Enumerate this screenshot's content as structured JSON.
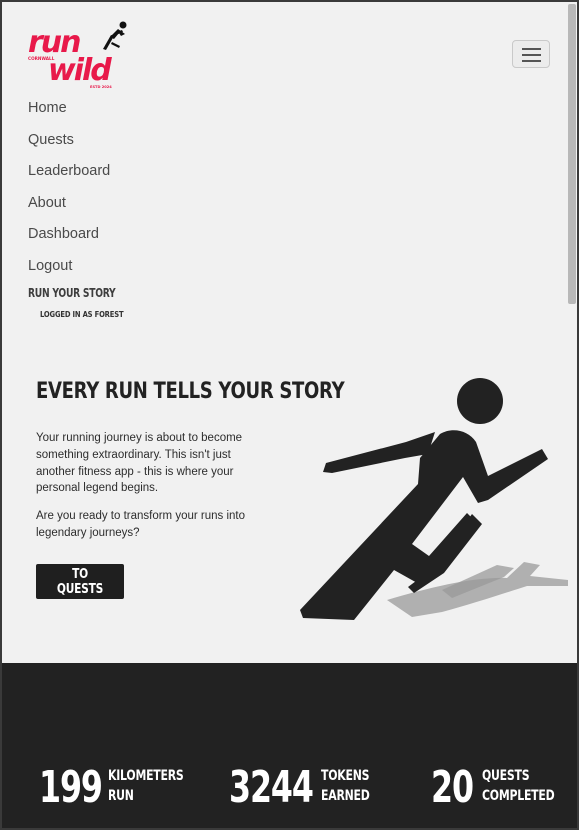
{
  "brand": {
    "logo_line1": "run",
    "logo_line2": "wild",
    "logo_region": "CORNWALL",
    "logo_est": "ESTD 2024",
    "accent_color": "#e8194a"
  },
  "header": {
    "menu_icon": "hamburger-icon"
  },
  "nav": {
    "items": [
      {
        "label": "Home"
      },
      {
        "label": "Quests"
      },
      {
        "label": "Leaderboard"
      },
      {
        "label": "About"
      },
      {
        "label": "Dashboard"
      },
      {
        "label": "Logout"
      }
    ],
    "tagline": "RUN YOUR STORY",
    "user_status": "LOGGED IN AS FOREST"
  },
  "hero": {
    "title": "EVERY RUN TELLS YOUR STORY",
    "paragraph1": "Your running journey is about to become something extraordinary. This isn't just another fitness app - this is where your personal legend begins.",
    "paragraph2": "Are you ready to transform your runs into legendary journeys?",
    "cta_label": "TO QUESTS",
    "illustration": "runner-icon"
  },
  "stats": [
    {
      "value": "199",
      "label_line1": "KILOMETERS",
      "label_line2": "RUN"
    },
    {
      "value": "3244",
      "label_line1": "TOKENS",
      "label_line2": "EARNED"
    },
    {
      "value": "20",
      "label_line1": "QUESTS",
      "label_line2": "COMPLETED"
    }
  ]
}
